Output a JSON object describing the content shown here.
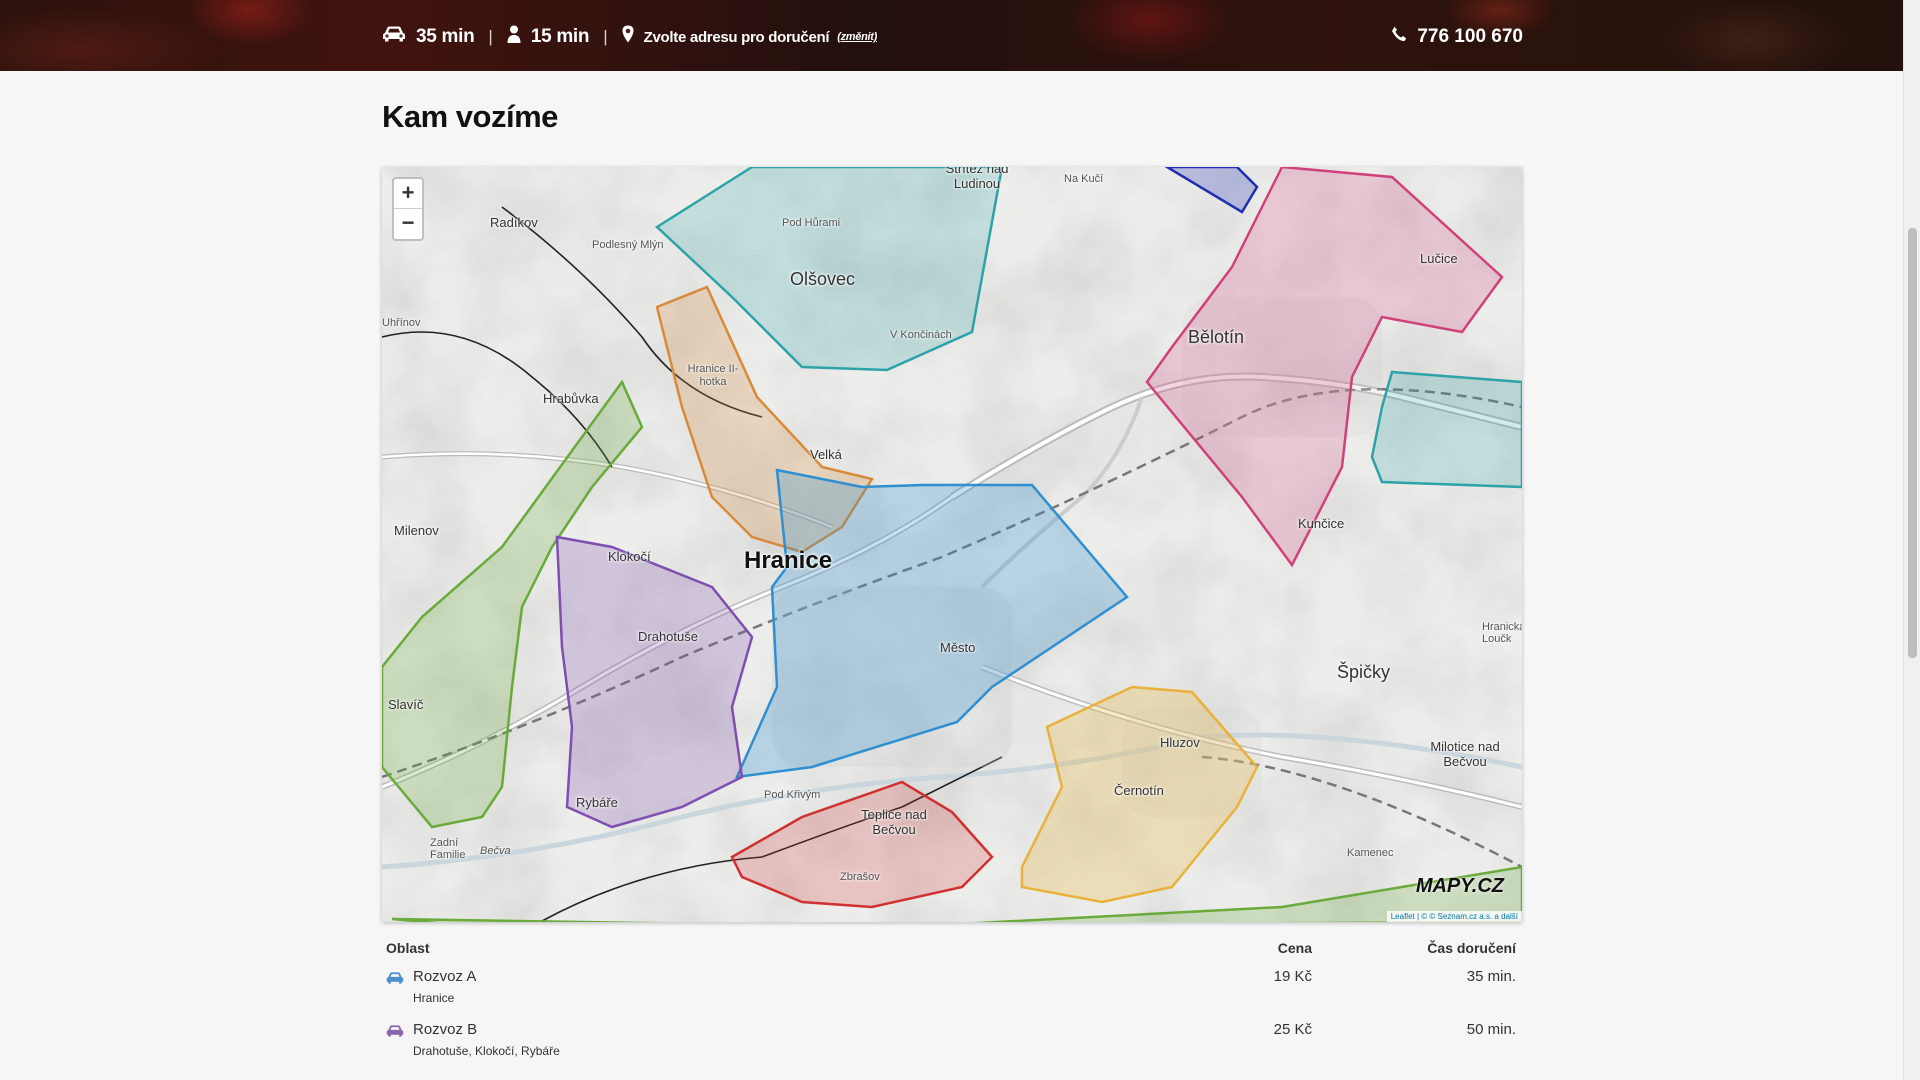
{
  "header": {
    "car_time": "35 min",
    "walk_time": "15 min",
    "address_prompt": "Zvolte adresu pro doručení",
    "change_link": "(změnit)",
    "phone": "776 100 670"
  },
  "page_title": "Kam vozíme",
  "map": {
    "zoom_in": "+",
    "zoom_out": "−",
    "logo": "MAPY.CZ",
    "attribution": "Leaflet | © © Seznam.cz a.s. a další",
    "labels": {
      "hranice": "Hranice",
      "olsovec": "Olšovec",
      "belotin": "Bělotín",
      "spicky": "Špičky",
      "cernotin": "Černotín",
      "teplice": "Teplice nad Bečvou",
      "klokoci": "Klokočí",
      "drahotuse": "Drahotuše",
      "rybare": "Rybáře",
      "radikov": "Radíkov",
      "hrabuvka": "Hrabůvka",
      "milenov": "Milenov",
      "slavic": "Slavíč",
      "lucice": "Lučice",
      "kuncice": "Kunčice",
      "hluzov": "Hluzov",
      "mesto": "Město",
      "velka": "Velká",
      "zbrasov": "Zbrašov",
      "milotice": "Milotice nad Bečvou",
      "strizez": "Střítež nad Ludinou",
      "uhrinov": "Uhřínov",
      "kamenec": "Kamenec",
      "pod_hurami": "Pod Hůrami",
      "v_koncinach": "V Končinách",
      "na_kuci": "Na Kučí",
      "podlesny": "Podlesný Mlýn",
      "pod_krivym": "Pod Křivým",
      "hranice_ii": "Hranice II-hotka",
      "zadni_familie": "Zadní Familie",
      "hranicka": "Hranická Loučk",
      "becva": "Bečva"
    }
  },
  "table": {
    "headers": {
      "area": "Oblast",
      "price": "Cena",
      "time": "Čas doručení"
    },
    "rows": [
      {
        "name": "Rozvoz A",
        "places": "Hranice",
        "price": "19 Kč",
        "time": "35 min.",
        "color": "#2f8fd0"
      },
      {
        "name": "Rozvoz B",
        "places": "Drahotuše, Klokočí, Rybáře",
        "price": "25 Kč",
        "time": "50 min.",
        "color": "#8a64b0"
      }
    ]
  },
  "colors": {
    "zone_a": "#2f8fd0",
    "zone_b": "#7e4fb0",
    "zone_c": "#d03030",
    "zone_olsovec": "#2ba3a8",
    "zone_belotin": "#d0407a",
    "zone_orange": "#d88a3a",
    "zone_yellow": "#e8b23a",
    "zone_green": "#6aaa3a"
  }
}
